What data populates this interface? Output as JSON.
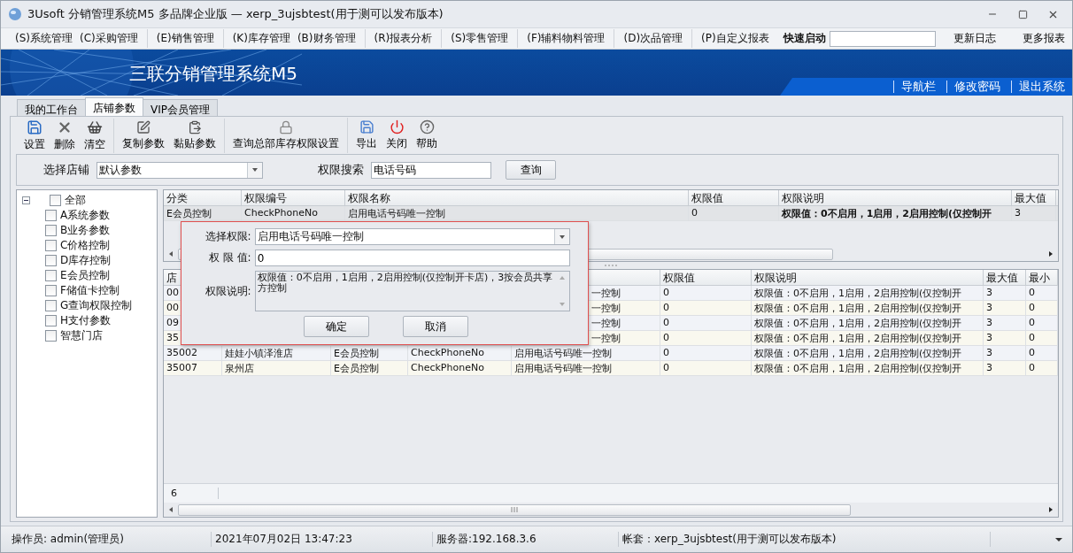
{
  "window": {
    "title": "3Usoft 分销管理系统M5 多品牌企业版 — xerp_3ujsbtest(用于测可以发布版本)"
  },
  "menu": {
    "groups": [
      [
        "(S)系统管理",
        "(C)采购管理"
      ],
      [
        "(E)销售管理"
      ],
      [
        "(K)库存管理",
        "(B)财务管理"
      ],
      [
        "(R)报表分析"
      ],
      [
        "(S)零售管理"
      ],
      [
        "(F)辅料物料管理"
      ],
      [
        "(D)次品管理"
      ],
      [
        "(P)自定义报表"
      ]
    ],
    "quick_launch": "快速启动",
    "links": [
      "更新日志",
      "更多报表"
    ]
  },
  "banner": {
    "title": "三联分销管理系统M5",
    "links": [
      "导航栏",
      "修改密码",
      "退出系统"
    ]
  },
  "tabs": [
    {
      "label": "我的工作台",
      "selected": false
    },
    {
      "label": "店铺参数",
      "selected": true
    },
    {
      "label": "VIP会员管理",
      "selected": false
    }
  ],
  "toolbar": {
    "groups": [
      [
        "设置",
        "删除",
        "清空"
      ],
      [
        "复制参数",
        "黏贴参数"
      ],
      [
        "查询总部库存权限设置"
      ],
      [
        "导出",
        "关闭",
        "帮助"
      ]
    ]
  },
  "filter": {
    "store_label": "选择店铺",
    "store_value": "默认参数",
    "search_label": "权限搜索",
    "search_value": "电话号码",
    "search_button": "查询"
  },
  "tree": {
    "label": "全部",
    "expanded": true,
    "checked": false,
    "children": [
      {
        "label": "A系统参数",
        "checked": false
      },
      {
        "label": "B业务参数",
        "checked": false
      },
      {
        "label": "C价格控制",
        "checked": false
      },
      {
        "label": "D库存控制",
        "checked": false
      },
      {
        "label": "E会员控制",
        "checked": false
      },
      {
        "label": "F储值卡控制",
        "checked": false
      },
      {
        "label": "G查询权限控制",
        "checked": false
      },
      {
        "label": "H支付参数",
        "checked": false
      },
      {
        "label": "智慧门店",
        "checked": false
      }
    ]
  },
  "upper_grid": {
    "columns": [
      "分类",
      "权限编号",
      "权限名称",
      "权限值",
      "权限说明",
      "最大值"
    ],
    "rows": [
      {
        "selected": true,
        "cells": [
          "E会员控制",
          "CheckPhoneNo",
          "启用电话号码唯一控制",
          "0",
          "权限值：0不启用，1启用，2启用控制(仅控制开",
          "3"
        ]
      }
    ]
  },
  "lower_grid": {
    "columns": [
      "店",
      null,
      null,
      null,
      null,
      "权限值",
      "权限说明",
      "最大值",
      "最小"
    ],
    "rows": [
      {
        "selected": false,
        "cells": [
          "00",
          null,
          null,
          null,
          "一控制",
          "0",
          "权限值：0不启用，1启用，2启用控制(仅控制开",
          "3",
          "0"
        ]
      },
      {
        "selected": false,
        "cells": [
          "00",
          null,
          null,
          null,
          "一控制",
          "0",
          "权限值：0不启用，1启用，2启用控制(仅控制开",
          "3",
          "0"
        ]
      },
      {
        "selected": false,
        "cells": [
          "09",
          null,
          null,
          null,
          "一控制",
          "0",
          "权限值：0不启用，1启用，2启用控制(仅控制开",
          "3",
          "0"
        ]
      },
      {
        "selected": false,
        "cells": [
          "35",
          null,
          null,
          null,
          "一控制",
          "0",
          "权限值：0不启用，1启用，2启用控制(仅控制开",
          "3",
          "0"
        ]
      },
      {
        "selected": false,
        "cells": [
          "35002",
          "娃娃小镇泽淮店",
          "E会员控制",
          "CheckPhoneNo",
          "启用电话号码唯一控制",
          "0",
          "权限值：0不启用，1启用，2启用控制(仅控制开",
          "3",
          "0"
        ]
      },
      {
        "selected": false,
        "cells": [
          "35007",
          "泉州店",
          "E会员控制",
          "CheckPhoneNo",
          "启用电话号码唯一控制",
          "0",
          "权限值：0不启用，1启用，2启用控制(仅控制开",
          "3",
          "0"
        ]
      }
    ],
    "row_count": "6"
  },
  "dialog": {
    "fields": [
      {
        "kind": "select",
        "label": "选择权限:",
        "value": "启用电话号码唯一控制"
      },
      {
        "kind": "input",
        "label": "权 限 值:",
        "value": "0"
      },
      {
        "kind": "textarea",
        "label": "权限说明:",
        "value": "权限值：0不启用，1启用，2启用控制(仅控制开卡店)，3按会员共享方控制"
      }
    ],
    "buttons": [
      "确定",
      "取消"
    ]
  },
  "status_bar": [
    "操作员: admin(管理员)",
    "2021年07月02日 13:47:23",
    "服务器:192.168.3.6",
    "帐套：xerp_3ujsbtest(用于测可以发布版本)"
  ]
}
